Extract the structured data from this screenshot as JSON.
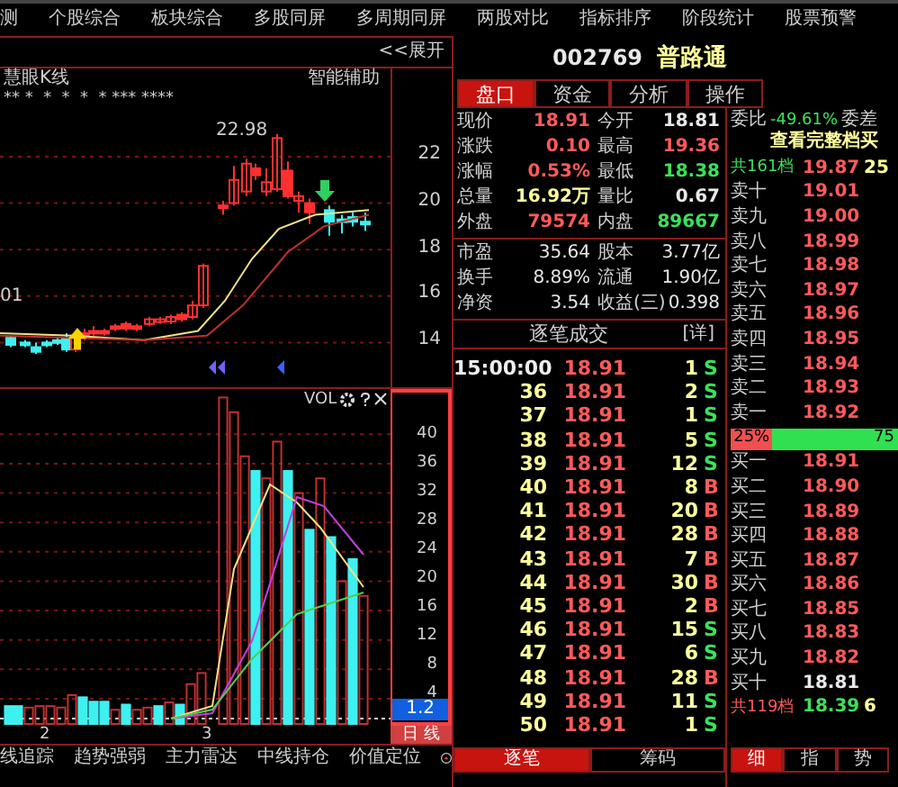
{
  "menu": [
    "测",
    "个股综合",
    "板块综合",
    "多股同屏",
    "多周期同屏",
    "两股对比",
    "指标排序",
    "阶段统计",
    "股票预警"
  ],
  "chart": {
    "expand": "<<展开",
    "indicator": "慧眼K线",
    "assist": "智能辅助",
    "signals": "** *  *  *  *  * *** ****",
    "high_label": "22.98",
    "low_label": "01",
    "price_ticks": [
      "22",
      "20",
      "18",
      "16",
      "14"
    ]
  },
  "volume": {
    "label": "VOL",
    "ticks": [
      "40",
      "36",
      "32",
      "28",
      "24",
      "20",
      "16",
      "12",
      "8",
      "4"
    ],
    "current": "1.2",
    "period": "日 线"
  },
  "x_labels": [
    "2",
    "3"
  ],
  "bottom_tabs": [
    "线追踪",
    "趋势强弱",
    "主力雷达",
    "中线持仓",
    "价值定位"
  ],
  "stock": {
    "code": "002769",
    "name": "普路通"
  },
  "panel_tabs": [
    {
      "label": "盘口",
      "selected": true
    },
    {
      "label": "资金",
      "selected": false
    },
    {
      "label": "分析",
      "selected": false
    },
    {
      "label": "操作",
      "selected": false
    }
  ],
  "quote": [
    {
      "label": "现价",
      "value": "18.91",
      "color": "#ff5a5a"
    },
    {
      "label": "今开",
      "value": "18.81",
      "color": "#e8e8e8"
    },
    {
      "label": "涨跌",
      "value": "0.10",
      "color": "#ff5a5a"
    },
    {
      "label": "最高",
      "value": "19.36",
      "color": "#ff5a5a"
    },
    {
      "label": "涨幅",
      "value": "0.53%",
      "color": "#ff5a5a"
    },
    {
      "label": "最低",
      "value": "18.38",
      "color": "#3ce05a"
    },
    {
      "label": "总量",
      "value": "16.92万",
      "color": "#ffff9a"
    },
    {
      "label": "量比",
      "value": "0.67",
      "color": "#e8e8e8"
    },
    {
      "label": "外盘",
      "value": "79574",
      "color": "#ff5a5a"
    },
    {
      "label": "内盘",
      "value": "89667",
      "color": "#3ce05a"
    }
  ],
  "fundamentals": [
    {
      "label": "市盈",
      "value": "35.64"
    },
    {
      "label": "股本",
      "value": "3.77亿"
    },
    {
      "label": "换手",
      "value": "8.89%"
    },
    {
      "label": "流通",
      "value": "1.90亿"
    },
    {
      "label": "净资",
      "value": "3.54"
    },
    {
      "label": "收益(三)",
      "value": "0.398"
    }
  ],
  "trades_header": {
    "title": "逐笔成交",
    "detail": "[详]"
  },
  "trades": [
    {
      "time": "15:00:00",
      "price": "18.91",
      "volume": "1",
      "side": "S",
      "color": "#3ce05a"
    },
    {
      "time": "36",
      "price": "18.91",
      "volume": "2",
      "side": "S",
      "color": "#3ce05a"
    },
    {
      "time": "37",
      "price": "18.91",
      "volume": "1",
      "side": "S",
      "color": "#3ce05a"
    },
    {
      "time": "38",
      "price": "18.91",
      "volume": "5",
      "side": "S",
      "color": "#3ce05a"
    },
    {
      "time": "39",
      "price": "18.91",
      "volume": "12",
      "side": "S",
      "color": "#3ce05a"
    },
    {
      "time": "40",
      "price": "18.91",
      "volume": "8",
      "side": "B",
      "color": "#ff5a5a"
    },
    {
      "time": "41",
      "price": "18.91",
      "volume": "20",
      "side": "B",
      "color": "#ff5a5a"
    },
    {
      "time": "42",
      "price": "18.91",
      "volume": "28",
      "side": "B",
      "color": "#ff5a5a"
    },
    {
      "time": "43",
      "price": "18.91",
      "volume": "7",
      "side": "B",
      "color": "#ff5a5a"
    },
    {
      "time": "44",
      "price": "18.91",
      "volume": "30",
      "side": "B",
      "color": "#ff5a5a"
    },
    {
      "time": "45",
      "price": "18.91",
      "volume": "2",
      "side": "B",
      "color": "#ff5a5a"
    },
    {
      "time": "46",
      "price": "18.91",
      "volume": "15",
      "side": "S",
      "color": "#3ce05a"
    },
    {
      "time": "47",
      "price": "18.91",
      "volume": "6",
      "side": "S",
      "color": "#3ce05a"
    },
    {
      "time": "48",
      "price": "18.91",
      "volume": "28",
      "side": "B",
      "color": "#ff5a5a"
    },
    {
      "time": "49",
      "price": "18.91",
      "volume": "11",
      "side": "S",
      "color": "#3ce05a"
    },
    {
      "time": "50",
      "price": "18.91",
      "volume": "1",
      "side": "S",
      "color": "#3ce05a"
    }
  ],
  "trade_tabs": [
    {
      "label": "逐笔",
      "selected": true
    },
    {
      "label": "筹码",
      "selected": false
    }
  ],
  "ratio": {
    "label": "委比",
    "value": "-49.61%",
    "label2": "委差"
  },
  "full_depth": "查看完整档买",
  "sell_total": {
    "label": "共161档",
    "price": "19.87",
    "volume": "25"
  },
  "asks": [
    {
      "label": "卖十",
      "price": "19.01",
      "color": "#ff5a5a"
    },
    {
      "label": "卖九",
      "price": "19.00",
      "color": "#ff5a5a"
    },
    {
      "label": "卖八",
      "price": "18.99",
      "color": "#ff5a5a"
    },
    {
      "label": "卖七",
      "price": "18.98",
      "color": "#ff5a5a"
    },
    {
      "label": "卖六",
      "price": "18.97",
      "color": "#ff5a5a"
    },
    {
      "label": "卖五",
      "price": "18.96",
      "color": "#ff5a5a"
    },
    {
      "label": "卖四",
      "price": "18.95",
      "color": "#ff5a5a"
    },
    {
      "label": "卖三",
      "price": "18.94",
      "color": "#ff5a5a"
    },
    {
      "label": "卖二",
      "price": "18.93",
      "color": "#ff5a5a"
    },
    {
      "label": "卖一",
      "price": "18.92",
      "color": "#ff5a5a"
    }
  ],
  "balance": {
    "sell": "25%",
    "buy": "75",
    "level": 0.25
  },
  "bids": [
    {
      "label": "买一",
      "price": "18.91",
      "color": "#ff5a5a"
    },
    {
      "label": "买二",
      "price": "18.90",
      "color": "#ff5a5a"
    },
    {
      "label": "买三",
      "price": "18.89",
      "color": "#ff5a5a"
    },
    {
      "label": "买四",
      "price": "18.88",
      "color": "#ff5a5a"
    },
    {
      "label": "买五",
      "price": "18.87",
      "color": "#ff5a5a"
    },
    {
      "label": "买六",
      "price": "18.86",
      "color": "#ff5a5a"
    },
    {
      "label": "买七",
      "price": "18.85",
      "color": "#ff5a5a"
    },
    {
      "label": "买八",
      "price": "18.83",
      "color": "#ff5a5a"
    },
    {
      "label": "买九",
      "price": "18.82",
      "color": "#ff5a5a"
    },
    {
      "label": "买十",
      "price": "18.81",
      "color": "#e8e8e8"
    }
  ],
  "buy_total": {
    "label": "共119档",
    "price": "18.39",
    "volume": "6"
  },
  "side_tabs": [
    {
      "label": "细",
      "selected": true
    },
    {
      "label": "指",
      "selected": false
    },
    {
      "label": "势",
      "selected": false
    }
  ]
}
